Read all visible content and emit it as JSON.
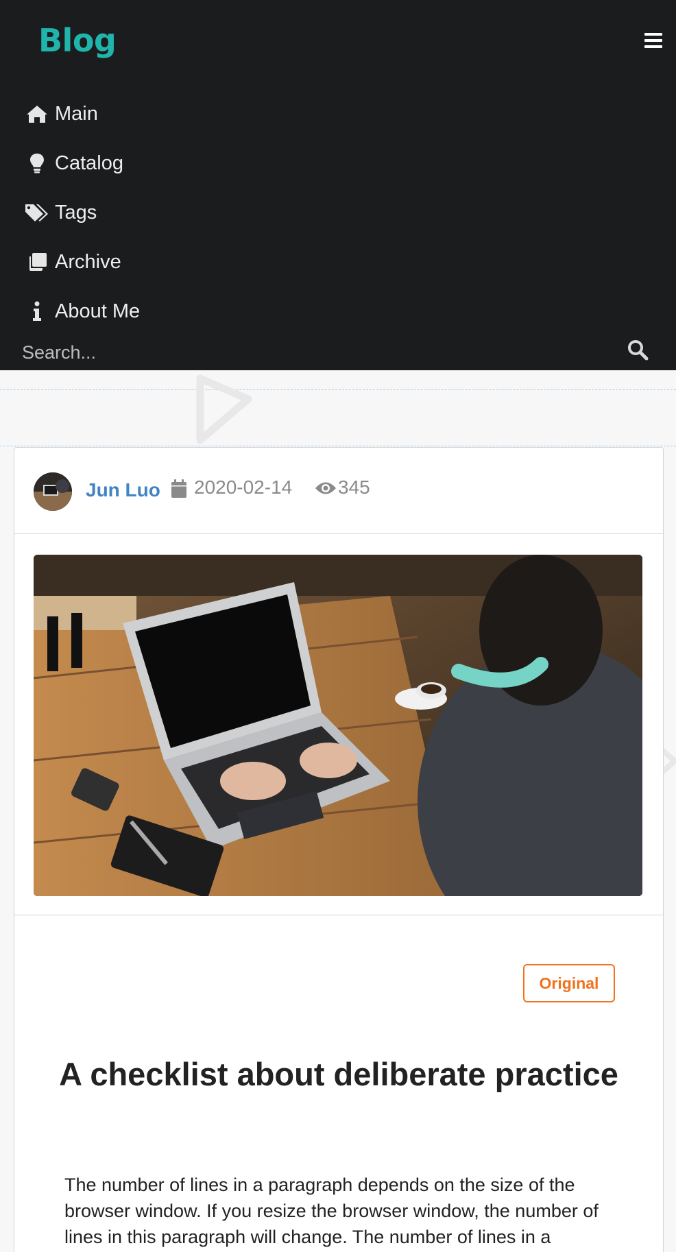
{
  "header": {
    "brand": "Blog",
    "nav": [
      {
        "label": "Main",
        "icon": "home-icon"
      },
      {
        "label": "Catalog",
        "icon": "lightbulb-icon"
      },
      {
        "label": "Tags",
        "icon": "tags-icon"
      },
      {
        "label": "Archive",
        "icon": "archive-icon"
      },
      {
        "label": "About Me",
        "icon": "info-icon"
      }
    ],
    "search": {
      "placeholder": "Search..."
    }
  },
  "post": {
    "author": "Jun Luo",
    "date": "2020-02-14",
    "views": "345",
    "badge": "Original",
    "title": "A checklist about deliberate practice",
    "paragraph": "The number of lines in a paragraph depends on the size of the browser window. If you resize the browser window, the number of lines in this paragraph will change. The number of lines in a"
  },
  "colors": {
    "header_bg": "#1b1c1d",
    "brand": "#1fb5ac",
    "author_link": "#4183c4",
    "badge": "#f2711c"
  }
}
